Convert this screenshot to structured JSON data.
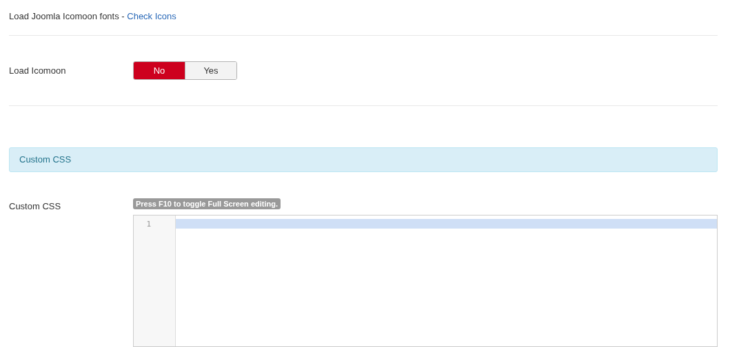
{
  "intro": {
    "text": "Load Joomla Icomoon fonts - ",
    "link": "Check Icons"
  },
  "load_icomoon": {
    "label": "Load Icomoon",
    "options": [
      {
        "label": "No",
        "selected": true
      },
      {
        "label": "Yes",
        "selected": false
      }
    ]
  },
  "section_alert": "Custom CSS",
  "custom_css": {
    "label": "Custom CSS",
    "hint": "Press F10 to toggle Full Screen editing.",
    "editor": {
      "lines": [
        {
          "number": "1",
          "active": true
        }
      ]
    }
  }
}
